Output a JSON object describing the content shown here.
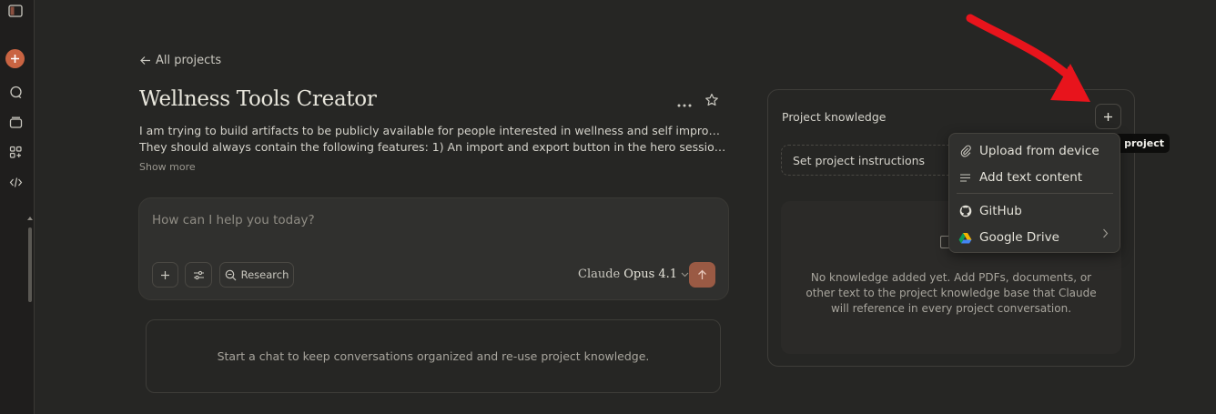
{
  "nav": {
    "back_label": "All projects"
  },
  "project": {
    "title": "Wellness Tools Creator",
    "description_line1": "I am trying to build artifacts to be publicly available for people interested in wellness and self improvement.",
    "description_line2": "They should always contain the following features: 1) An import and export button in the hero session for...",
    "show_more": "Show more"
  },
  "composer": {
    "placeholder": "How can I help you today?",
    "research_label": "Research",
    "model_prefix": "Claude ",
    "model_name": "Opus 4.1"
  },
  "hint": {
    "text": "Start a chat to keep conversations organized and re-use project knowledge."
  },
  "knowledge": {
    "title": "Project knowledge",
    "instructions_label": "Set project instructions",
    "empty_text": "No knowledge added yet. Add PDFs, documents, or other text to the project knowledge base that Claude will reference in every project conversation."
  },
  "tooltip": {
    "text": "o project"
  },
  "menu": {
    "items": [
      {
        "label": "Upload from device",
        "icon": "paperclip-icon"
      },
      {
        "label": "Add text content",
        "icon": "text-lines-icon"
      },
      {
        "label": "GitHub",
        "icon": "github-icon"
      },
      {
        "label": "Google Drive",
        "icon": "google-drive-icon"
      }
    ]
  },
  "colors": {
    "accent": "#c96442",
    "send_button": "#9a5a44",
    "annotation_arrow": "#e8141c"
  }
}
